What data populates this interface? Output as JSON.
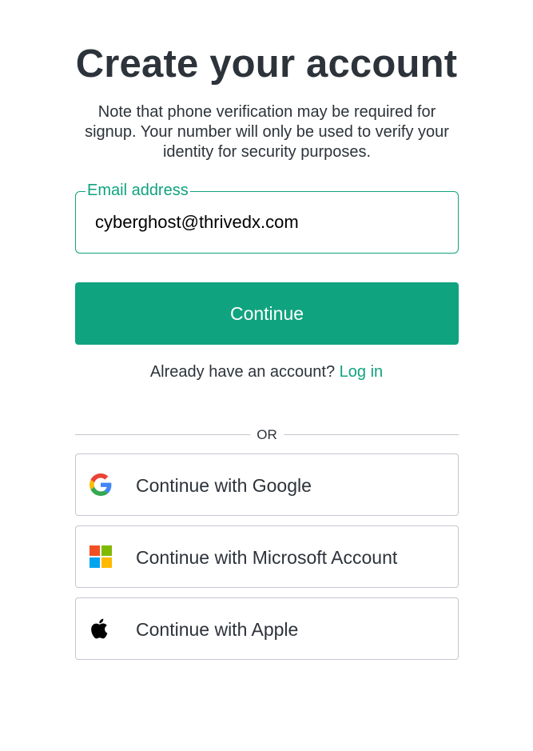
{
  "page": {
    "title": "Create your account",
    "subtitle": "Note that phone verification may be required for signup. Your number will only be used to verify your identity for security purposes."
  },
  "email": {
    "label": "Email address",
    "value": "cyberghost@thrivedx.com"
  },
  "continue_button": {
    "label": "Continue"
  },
  "login": {
    "prompt": "Already have an account?",
    "link_label": "Log in"
  },
  "divider": {
    "label": "OR"
  },
  "social": [
    {
      "label": "Continue with Google",
      "icon": "google-icon"
    },
    {
      "label": "Continue with Microsoft Account",
      "icon": "microsoft-icon"
    },
    {
      "label": "Continue with Apple",
      "icon": "apple-icon"
    }
  ],
  "colors": {
    "accent": "#10a37f",
    "text": "#2d333a",
    "border": "#c2c8d0"
  }
}
